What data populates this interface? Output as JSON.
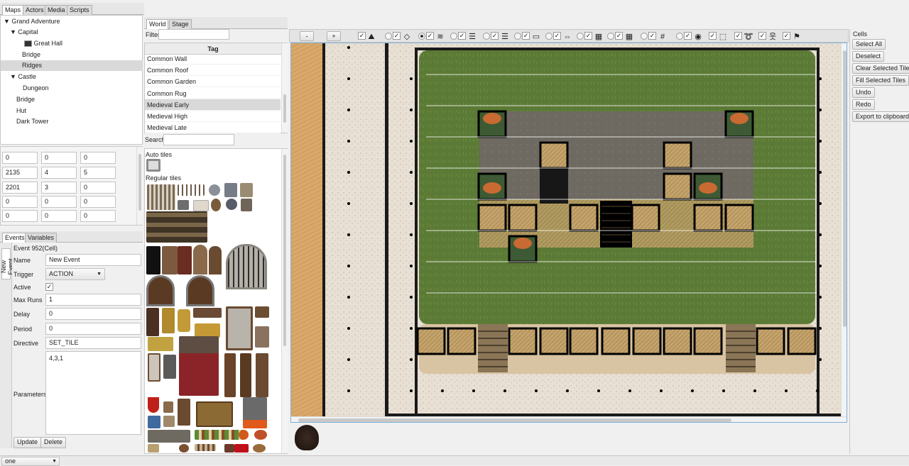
{
  "left_tabs": [
    "Maps",
    "Actors",
    "Media",
    "Scripts"
  ],
  "map_tree": [
    {
      "label": "Grand Adventure",
      "level": 0,
      "expanded": true
    },
    {
      "label": "Capital",
      "level": 1,
      "expanded": true
    },
    {
      "label": "Great Hall",
      "level": 2,
      "icon": "map-icon"
    },
    {
      "label": "Bridge",
      "level": 2
    },
    {
      "label": "Ridges",
      "level": 2,
      "selected": true
    },
    {
      "label": "Castle",
      "level": 1,
      "expanded": true
    },
    {
      "label": "Dungeon",
      "level": 2
    },
    {
      "label": "Bridge",
      "level": 1
    },
    {
      "label": "Hut",
      "level": 1
    },
    {
      "label": "Dark Tower",
      "level": 1
    }
  ],
  "grid_values": [
    [
      "0",
      "0",
      "0"
    ],
    [
      "2135",
      "4",
      "5"
    ],
    [
      "2201",
      "3",
      "0"
    ],
    [
      "0",
      "0",
      "0"
    ],
    [
      "0",
      "0",
      "0"
    ]
  ],
  "bottom_tabs": [
    "Events",
    "Variables"
  ],
  "side_tab": "New Event",
  "event": {
    "header": "Event 952(Cell)",
    "name_label": "Name",
    "name_value": "New Event",
    "trigger_label": "Trigger",
    "trigger_value": "ACTION",
    "active_label": "Active",
    "active_check": "✓",
    "maxruns_label": "Max Runs",
    "maxruns_value": "1",
    "delay_label": "Delay",
    "delay_value": "0",
    "period_label": "Period",
    "period_value": "0",
    "directive_label": "Directive",
    "directive_value": "SET_TILE",
    "parameters_label": "Parameters",
    "parameters_value": "4,3,1",
    "update_button": "Update",
    "delete_button": "Delete"
  },
  "mid_tabs": [
    "World",
    "Stage"
  ],
  "filter_label": "Filter",
  "tag_header": "Tag",
  "tags": [
    {
      "label": "Common Wall"
    },
    {
      "label": "Common Roof"
    },
    {
      "label": "Common Garden"
    },
    {
      "label": "Common Rug"
    },
    {
      "label": "Medieval Early",
      "selected": true
    },
    {
      "label": "Medieval High"
    },
    {
      "label": "Medieval Late"
    }
  ],
  "search_label": "Search",
  "auto_tiles_label": "Auto tiles",
  "regular_tiles_label": "Regular tiles",
  "toolbar": {
    "zoom_out": "-",
    "zoom_in": "+",
    "items": [
      {
        "icon": "mountain-icon",
        "glyph": "⛰",
        "check": "✓"
      },
      {
        "icon": "diamond-layer-icon",
        "glyph": "◇",
        "check": "✓"
      },
      {
        "icon": "layers-icon",
        "glyph": "≋",
        "check": "✓"
      },
      {
        "icon": "layers-stack-icon",
        "glyph": "☰",
        "check": "✓"
      },
      {
        "icon": "flat-layer-icon",
        "glyph": "▭",
        "check": "✓"
      },
      {
        "icon": "road-icon",
        "glyph": "⇔",
        "check": "✓"
      },
      {
        "icon": "wall-icon",
        "glyph": "▦",
        "check": "✓"
      },
      {
        "icon": "grid-icon",
        "glyph": "#",
        "check": "✓"
      },
      {
        "icon": "eye-icon",
        "glyph": "◉",
        "check": "✓"
      },
      {
        "icon": "selection-icon",
        "glyph": "⬚",
        "check": "✓"
      },
      {
        "icon": "lasso-icon",
        "glyph": "➰",
        "check": "✓"
      },
      {
        "icon": "actor-icon",
        "glyph": "웃",
        "check": "✓"
      },
      {
        "icon": "event-icon",
        "glyph": "⚑",
        "check": "✓"
      }
    ]
  },
  "cells_panel": {
    "title": "Cells",
    "buttons": [
      "Select All",
      "Deselect",
      "Clear Selected Tiles",
      "Fill Selected Tiles",
      "Undo",
      "Redo",
      "Export to clipboard"
    ]
  },
  "status_dropdown": "one",
  "colors": {
    "grass": "#5b7a35",
    "stone_floor": "#6e6a62",
    "sand_path": "#d9a86a",
    "gravel": "#e8e0d4"
  }
}
